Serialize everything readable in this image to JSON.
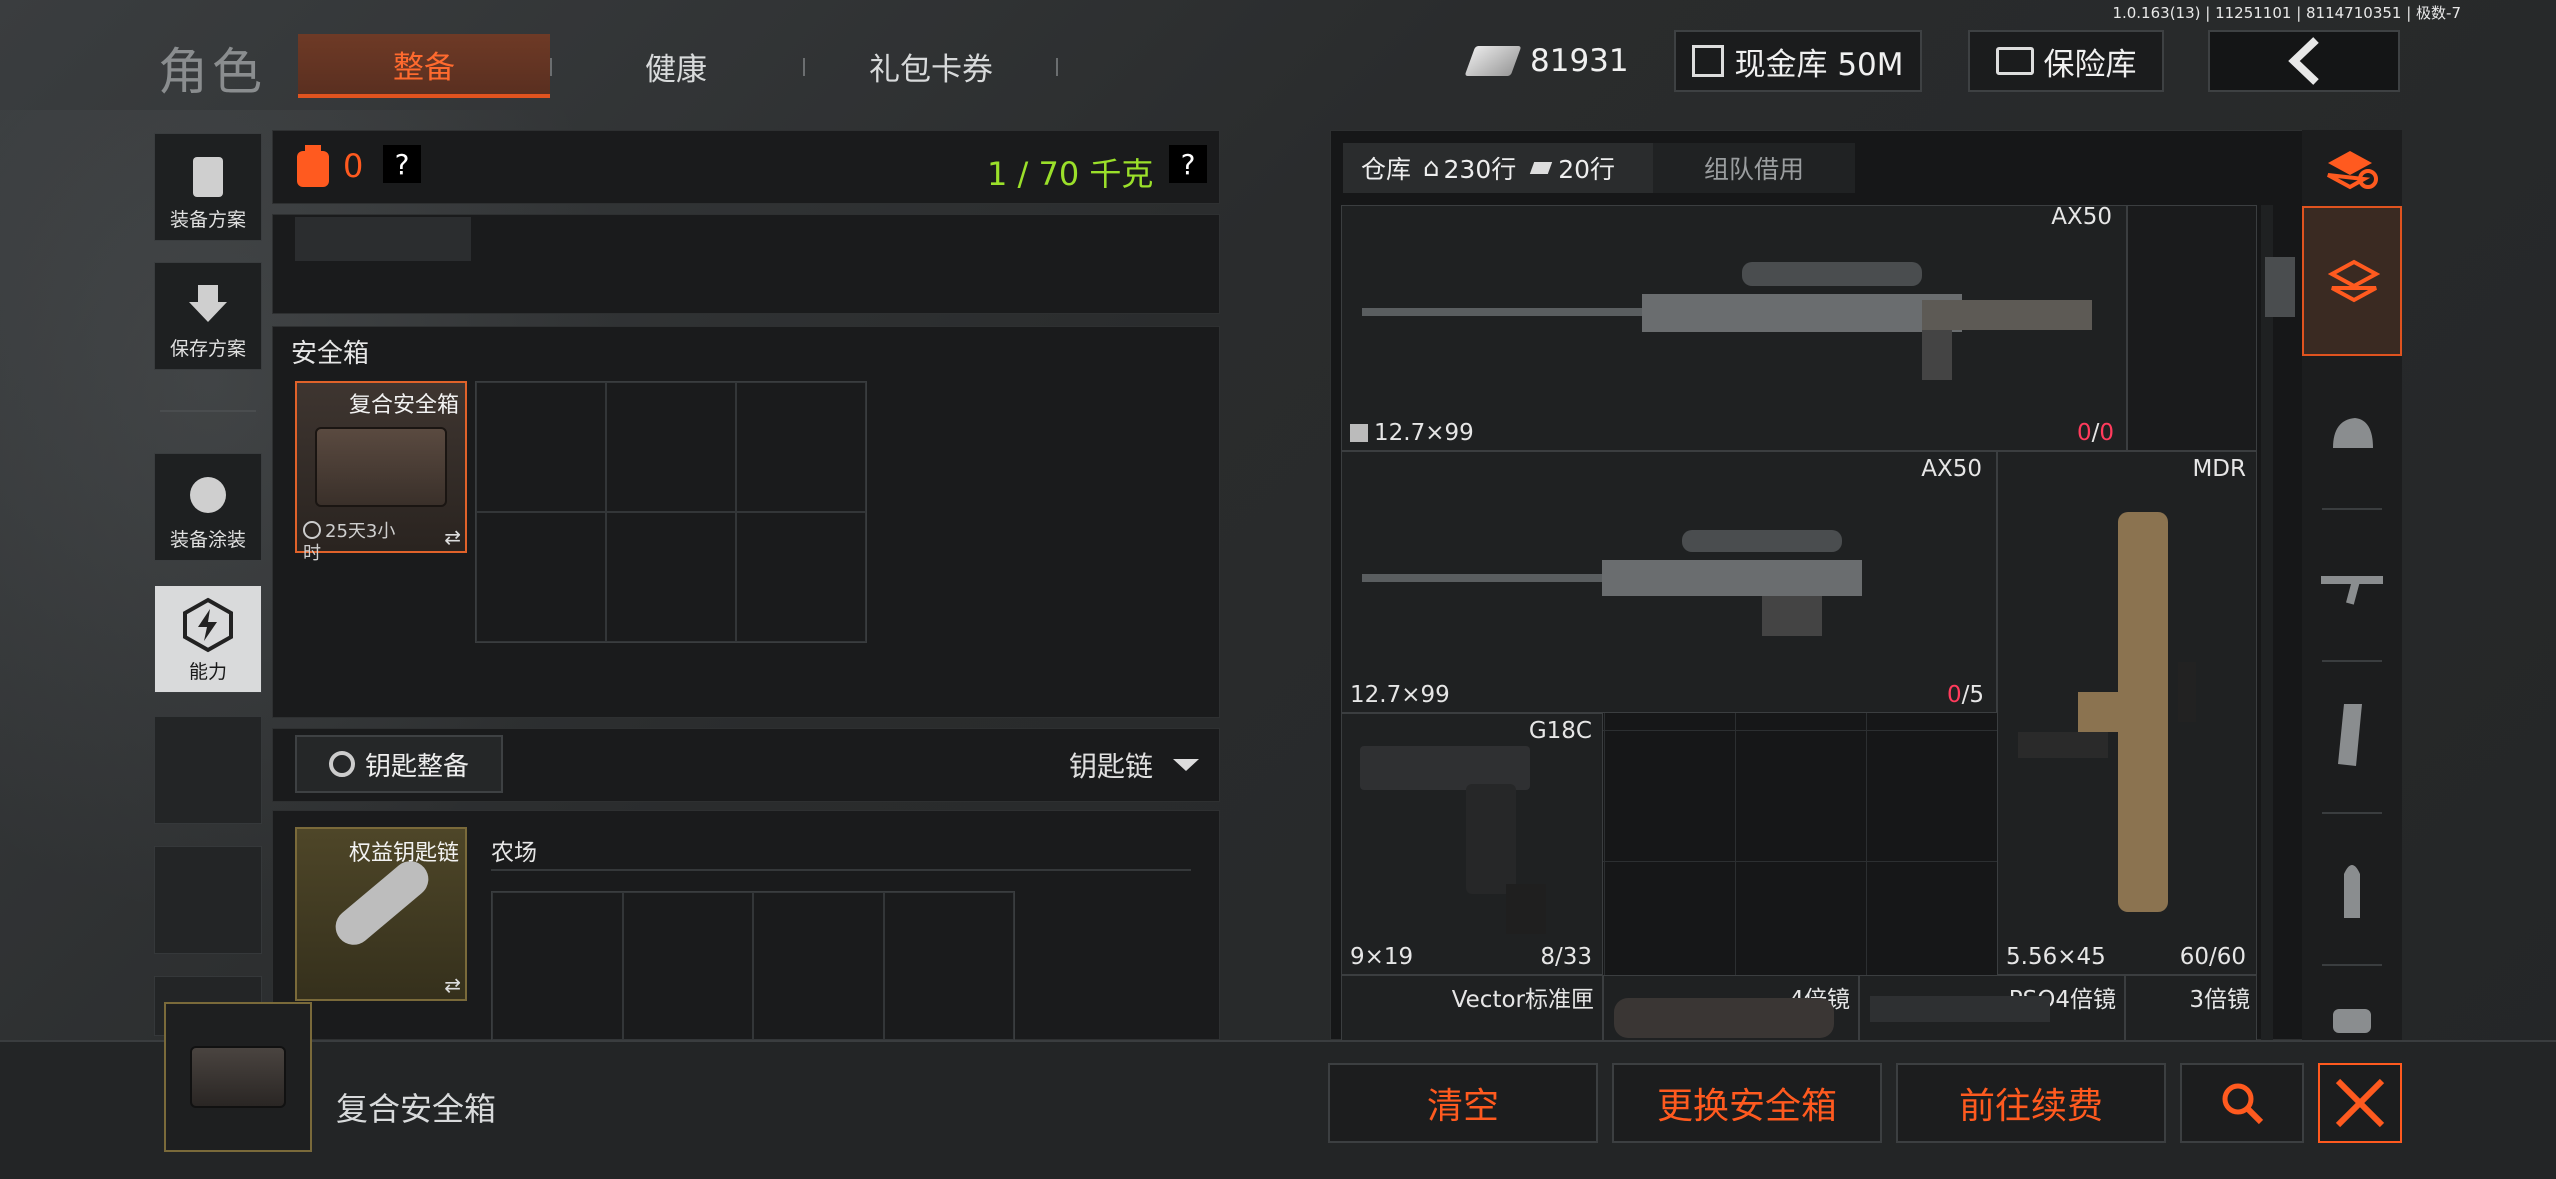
{
  "version": "1.0.163(13) | 11251101 | 8114710351 | 极数-7",
  "header": {
    "role_title": "角色",
    "tabs": [
      {
        "label": "整备",
        "active": true
      },
      {
        "label": "健康",
        "active": false
      },
      {
        "label": "礼包卡券",
        "active": false
      }
    ],
    "money": "81931",
    "cash_vault": "现金库 50M",
    "safe_vault": "保险库"
  },
  "sidebar": {
    "items": [
      {
        "label": "装备方案"
      },
      {
        "label": "保存方案"
      },
      {
        "label": "装备涂装"
      },
      {
        "label": "能力"
      }
    ]
  },
  "loadout": {
    "count": "0",
    "help": "?",
    "weight": "1 / 70 千克",
    "safebox_title": "安全箱",
    "safebox_name": "复合安全箱",
    "safebox_timer": "25天3小时",
    "keychain_button": "钥匙整备",
    "keychain_dropdown": "钥匙链",
    "keychain_item": "权益钥匙链",
    "keychain_section": "农场"
  },
  "warehouse": {
    "tab_label": "仓库",
    "rows_home": "230行",
    "rows_ticket": "20行",
    "team_borrow": "组队借用",
    "items": [
      {
        "name": "AX50",
        "caliber": "12.7×99",
        "ammo_current": "0",
        "ammo_max": "0"
      },
      {
        "name": "AX50",
        "caliber": "12.7×99",
        "ammo_current": "0",
        "ammo_max": "5"
      },
      {
        "name": "MDR",
        "caliber": "5.56×45",
        "ammo": "60/60"
      },
      {
        "name": "G18C",
        "caliber": "9×19",
        "ammo": "8/33"
      },
      {
        "name": "Vector标准匣"
      },
      {
        "name": "4倍镜"
      },
      {
        "name": "PSO4倍镜"
      },
      {
        "name": "3倍镜"
      }
    ]
  },
  "footer": {
    "selected_item": "复合安全箱",
    "clear": "清空",
    "change_safebox": "更换安全箱",
    "renew": "前往续费"
  },
  "colors": {
    "accent": "#ff5a1f",
    "weight_green": "#9be02a",
    "ammo_red": "#ff3b5c"
  }
}
